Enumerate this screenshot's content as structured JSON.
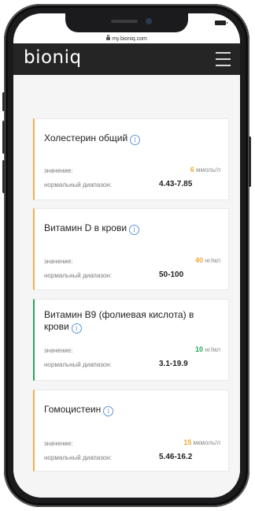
{
  "browser": {
    "url": "my.bioniq.com"
  },
  "header": {
    "logo": "bioniq"
  },
  "cards": [
    {
      "title": "Холестерин общий",
      "value_label": "значение:",
      "value": "6",
      "unit": "ммоль/л",
      "range_label": "нормальный диапазон:",
      "range": "4.43-7.85",
      "status": "warn"
    },
    {
      "title": "Витамин D в крови",
      "value_label": "значение:",
      "value": "40",
      "unit": "нг/мл",
      "range_label": "нормальный диапазон:",
      "range": "50-100",
      "status": "warn"
    },
    {
      "title": "Витамин B9 (фолиевая кислота) в крови",
      "value_label": "значение:",
      "value": "10",
      "unit": "нг/мл",
      "range_label": "нормальный диапазон:",
      "range": "3.1-19.9",
      "status": "good"
    },
    {
      "title": "Гомоцистеин",
      "value_label": "значение:",
      "value": "15",
      "unit": "мкмоль/л",
      "range_label": "нормальный диапазон:",
      "range": "5.46-16.2",
      "status": "warn"
    }
  ],
  "icons": {
    "info": "info-icon",
    "menu": "hamburger-menu-icon",
    "lock": "lock-icon"
  },
  "colors": {
    "warning": "#f0a93a",
    "normal": "#27a55a",
    "info": "#5f93d8",
    "header": "#252525"
  }
}
